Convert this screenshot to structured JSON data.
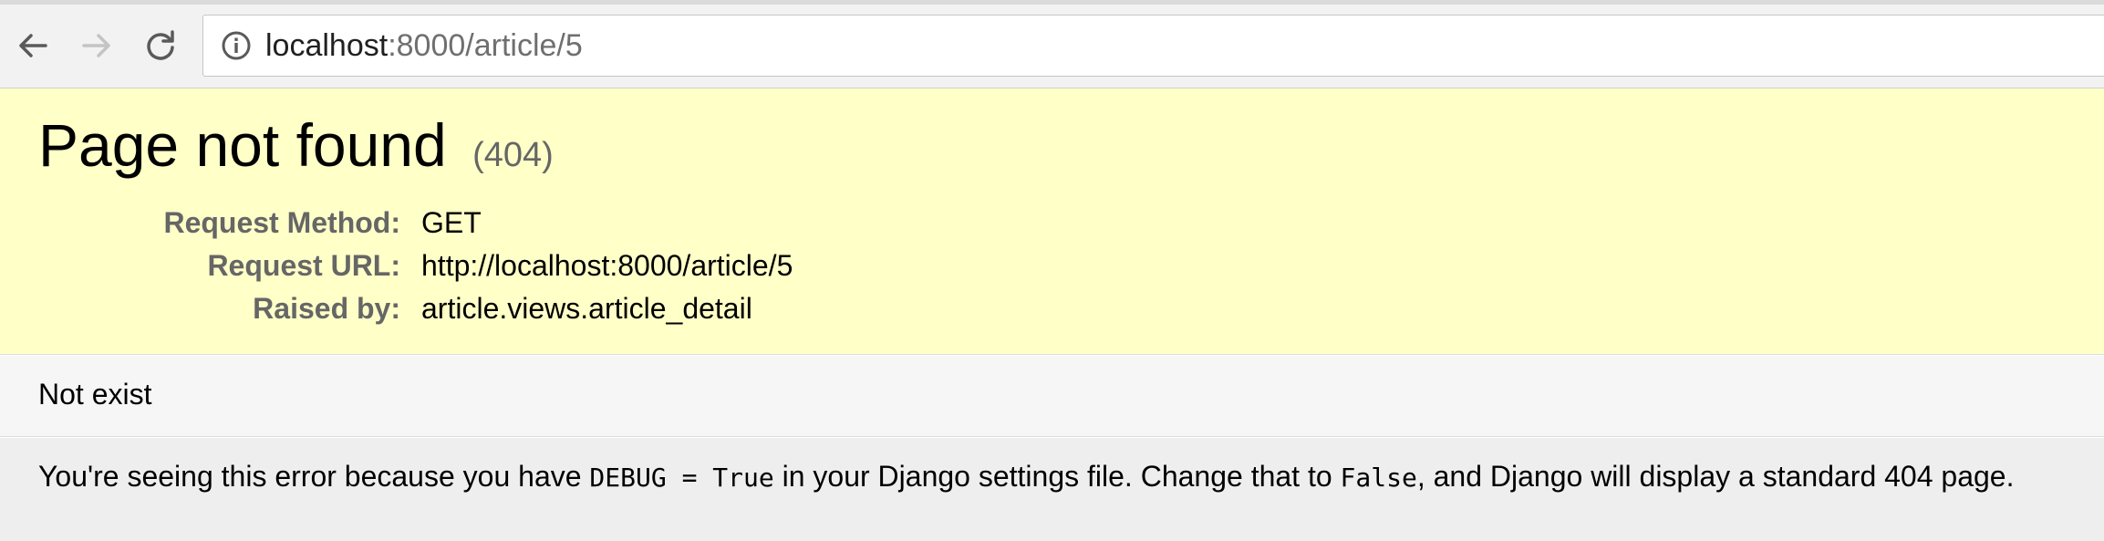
{
  "browser": {
    "url_host": "localhost",
    "url_rest": ":8000/article/5",
    "icons": {
      "back": "back-arrow-icon",
      "forward": "forward-arrow-icon",
      "reload": "reload-icon",
      "info": "info-icon"
    },
    "forward_enabled": false
  },
  "error": {
    "title": "Page not found",
    "code": "(404)",
    "meta": [
      {
        "label": "Request Method:",
        "value": "GET"
      },
      {
        "label": "Request URL:",
        "value": "http://localhost:8000/article/5"
      },
      {
        "label": "Raised by:",
        "value": "article.views.article_detail"
      }
    ],
    "info_message": "Not exist"
  },
  "explanation": {
    "part1": "You're seeing this error because you have ",
    "code1": "DEBUG = True",
    "part2": " in your Django settings file. Change that to ",
    "code2": "False",
    "part3": ", and Django will display a standard 404 page."
  },
  "colors": {
    "summary_bg": "#ffffc8",
    "info_bg": "#f6f6f6",
    "explanation_bg": "#eeeeee",
    "label_gray": "#666666"
  }
}
